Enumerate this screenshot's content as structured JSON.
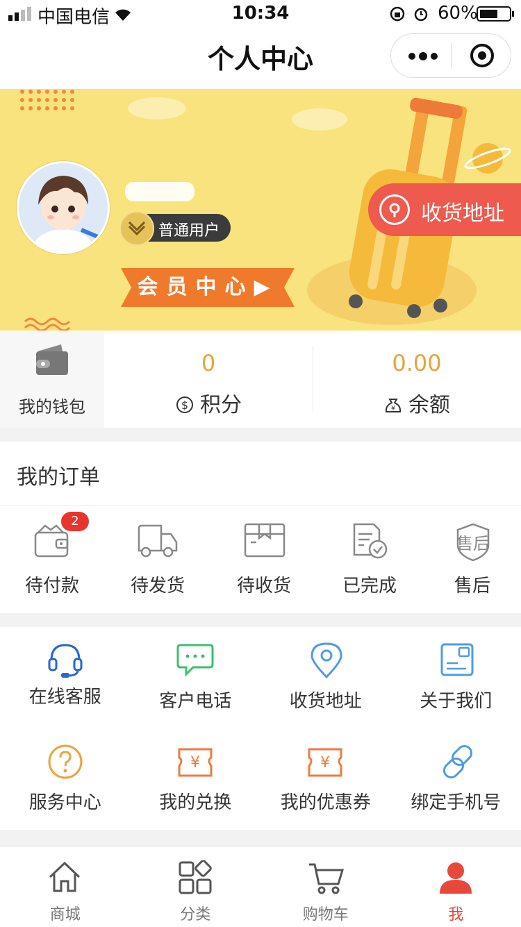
{
  "status": {
    "carrier": "中国电信",
    "time": "10:34",
    "battery": "60%"
  },
  "nav": {
    "title": "个人中心"
  },
  "banner": {
    "user_level": "普通用户",
    "member_center": "会员中心",
    "address_button": "收货地址"
  },
  "wallet": {
    "label": "我的钱包",
    "points": {
      "value": "0",
      "label": "积分"
    },
    "balance": {
      "value": "0.00",
      "label": "余额"
    }
  },
  "orders": {
    "title": "我的订单",
    "items": [
      {
        "label": "待付款",
        "badge": "2",
        "icon": "wallet-icon"
      },
      {
        "label": "待发货",
        "icon": "truck-icon"
      },
      {
        "label": "待收货",
        "icon": "box-icon"
      },
      {
        "label": "已完成",
        "icon": "completed-doc-icon"
      },
      {
        "label": "售后",
        "icon": "after-sales-shield-icon"
      }
    ]
  },
  "services": {
    "items": [
      {
        "label": "在线客服",
        "icon": "headset-icon",
        "color": "#2a67c9"
      },
      {
        "label": "客户电话",
        "icon": "chat-bubble-icon",
        "color": "#3cbf6a"
      },
      {
        "label": "收货地址",
        "icon": "location-pin-icon",
        "color": "#4e9be6"
      },
      {
        "label": "关于我们",
        "icon": "card-icon",
        "color": "#4e9be6"
      },
      {
        "label": "服务中心",
        "icon": "question-icon",
        "color": "#f0a23c"
      },
      {
        "label": "我的兑换",
        "icon": "ticket-yen-icon",
        "color": "#f07a3c"
      },
      {
        "label": "我的优惠券",
        "icon": "coupon-yen-icon",
        "color": "#f07a3c"
      },
      {
        "label": "绑定手机号",
        "icon": "link-icon",
        "color": "#4e9be6"
      }
    ]
  },
  "tabbar": {
    "items": [
      {
        "label": "商城",
        "icon": "home-icon"
      },
      {
        "label": "分类",
        "icon": "category-icon"
      },
      {
        "label": "购物车",
        "icon": "cart-icon"
      },
      {
        "label": "我",
        "icon": "user-icon",
        "active": true
      }
    ],
    "active_color": "#e8473c"
  }
}
